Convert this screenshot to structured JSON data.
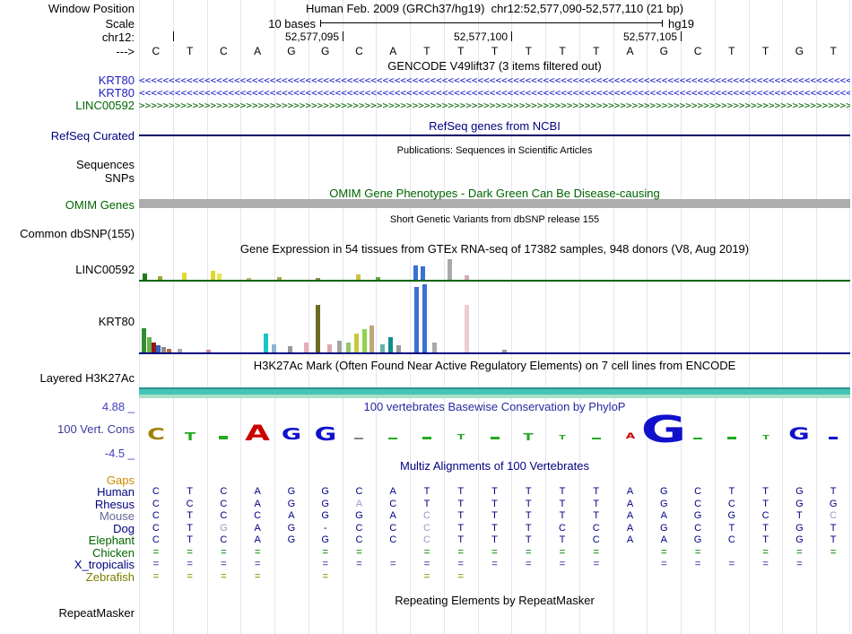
{
  "colors": {
    "grid": "#e2e5f2",
    "navy": "#000080",
    "light_base": "#9a9ac8",
    "gencode_blue": "#2020c8",
    "gene_green": "#006400",
    "omim_bar": "#adadad",
    "band_teal": "#45c4b4",
    "gaps_orange": "#cc8800",
    "phylop_scale_blue": "#4040c0"
  },
  "header": {
    "window_position_label": "Window Position",
    "title": "Human Feb. 2009 (GRCh37/hg19)  chr12:52,577,090-52,577,110 (21 bp)",
    "scale_label": "Scale",
    "scale_value": "10 bases",
    "assembly": "hg19",
    "chrom_label": "chr12:",
    "strand_label": "--->",
    "position_ticks": [
      {
        "label": "",
        "boundary": 1
      },
      {
        "label": "52,577,095",
        "boundary": 6
      },
      {
        "label": "52,577,100",
        "boundary": 11
      },
      {
        "label": "52,577,105",
        "boundary": 16
      }
    ],
    "sequence": [
      "C",
      "T",
      "C",
      "A",
      "G",
      "G",
      "C",
      "A",
      "T",
      "T",
      "T",
      "T",
      "T",
      "T",
      "A",
      "G",
      "C",
      "T",
      "T",
      "G",
      "T"
    ]
  },
  "tracks": {
    "gencode": {
      "title": "GENCODE V49lift37 (3 items filtered out)",
      "items": [
        {
          "label": "KRT80",
          "direction": "<",
          "color": "#2020c8"
        },
        {
          "label": "KRT80",
          "direction": "<",
          "color": "#2020c8"
        },
        {
          "label": "LINC00592",
          "direction": ">",
          "color": "#006400"
        }
      ]
    },
    "refseq": {
      "title": "RefSeq genes from NCBI",
      "label": "RefSeq Curated"
    },
    "publications": {
      "title": "Publications: Sequences in Scientific Articles",
      "labels": [
        "Sequences",
        "SNPs"
      ]
    },
    "omim": {
      "title": "OMIM Gene Phenotypes - Dark Green Can Be Disease-causing",
      "label": "OMIM Genes"
    },
    "dbsnp": {
      "title": "Short Genetic Variants from dbSNP release 155",
      "label": "Common dbSNP(155)"
    },
    "gtex": {
      "title": "Gene Expression in 54 tissues from GTEx RNA-seq of 17382 samples, 948 donors (V8, Aug 2019)",
      "genes": [
        {
          "label": "LINC00592",
          "baseline_color": "#006400",
          "bars": [
            [
              4,
              8,
              "#1f7a1f"
            ],
            [
              21,
              5,
              "#9aa832"
            ],
            [
              48,
              9,
              "#e0d939"
            ],
            [
              80,
              11,
              "#ded52f"
            ],
            [
              87,
              8,
              "#eae54f"
            ],
            [
              120,
              3,
              "#bbbb66"
            ],
            [
              154,
              4,
              "#a8a84a"
            ],
            [
              197,
              3,
              "#8a8a4a"
            ],
            [
              242,
              7,
              "#cdc344"
            ],
            [
              264,
              4,
              "#6aa24a"
            ],
            [
              306,
              17,
              "#3b6fd4"
            ],
            [
              314,
              16,
              "#3b6fd4"
            ],
            [
              344,
              24,
              "#a9a9a9"
            ],
            [
              363,
              6,
              "#d9a9b9"
            ]
          ]
        },
        {
          "label": "KRT80",
          "baseline_color": "#000080",
          "bars": [
            [
              3,
              28,
              "#2f8f2f"
            ],
            [
              9,
              18,
              "#6ab04c"
            ],
            [
              14,
              12,
              "#8b1a1a"
            ],
            [
              19,
              9,
              "#3a5fbf"
            ],
            [
              25,
              7,
              "#8a8a8a"
            ],
            [
              31,
              5,
              "#b06a3a"
            ],
            [
              43,
              5,
              "#a9a9a9"
            ],
            [
              75,
              4,
              "#c98a9a"
            ],
            [
              139,
              22,
              "#19c5c5"
            ],
            [
              148,
              10,
              "#8ab4d9"
            ],
            [
              166,
              8,
              "#979797"
            ],
            [
              184,
              12,
              "#e8a9b9"
            ],
            [
              197,
              54,
              "#6b6b22"
            ],
            [
              210,
              10,
              "#d9a9a9"
            ],
            [
              221,
              14,
              "#a3a3a3"
            ],
            [
              231,
              12,
              "#95c46a"
            ],
            [
              240,
              22,
              "#c9c93a"
            ],
            [
              249,
              27,
              "#8fd44f"
            ],
            [
              257,
              31,
              "#bda87a"
            ],
            [
              269,
              10,
              "#6ab0b0"
            ],
            [
              278,
              18,
              "#0f8f8f"
            ],
            [
              287,
              9,
              "#9a9a9a"
            ],
            [
              307,
              74,
              "#3b6fd4"
            ],
            [
              316,
              77,
              "#3b6fd4"
            ],
            [
              327,
              12,
              "#a9a9a9"
            ],
            [
              363,
              54,
              "#eccbd2"
            ],
            [
              405,
              4,
              "#9a9a9a"
            ]
          ]
        }
      ]
    },
    "h3k27ac": {
      "title": "H3K27Ac Mark (Often Found Near Active Regulatory Elements) on 7 cell lines from ENCODE",
      "label": "Layered H3K27Ac"
    },
    "conservation": {
      "title": "100 vertebrates Basewise Conservation by PhyloP",
      "label": "100 Vert. Cons",
      "scale_max": "4.88 _",
      "scale_min": "-4.5 _",
      "logo": [
        {
          "l": "C",
          "c": "#a08000",
          "h": 13
        },
        {
          "l": "T",
          "c": "#22aa22",
          "h": 9
        },
        {
          "l": "-",
          "c": "#22aa22",
          "h": 4
        },
        {
          "l": "A",
          "c": "#cc0000",
          "h": 18
        },
        {
          "l": "G",
          "c": "#1111cc",
          "h": 13
        },
        {
          "l": "G",
          "c": "#1111cc",
          "h": 15
        },
        {
          "l": "-",
          "c": "#888888",
          "h": 2
        },
        {
          "l": "-",
          "c": "#22aa22",
          "h": 2
        },
        {
          "l": "-",
          "c": "#22aa22",
          "h": 3
        },
        {
          "l": "T",
          "c": "#22aa22",
          "h": 6
        },
        {
          "l": "-",
          "c": "#22aa22",
          "h": 3
        },
        {
          "l": "T",
          "c": "#22aa22",
          "h": 8
        },
        {
          "l": "T",
          "c": "#22aa22",
          "h": 5
        },
        {
          "l": "-",
          "c": "#22aa22",
          "h": 2
        },
        {
          "l": "A",
          "c": "#cc0000",
          "h": 7
        },
        {
          "l": "G",
          "c": "#1111cc",
          "h": 30
        },
        {
          "l": "-",
          "c": "#22aa22",
          "h": 2
        },
        {
          "l": "-",
          "c": "#22aa22",
          "h": 3
        },
        {
          "l": "T",
          "c": "#22aa22",
          "h": 5
        },
        {
          "l": "G",
          "c": "#1111cc",
          "h": 14
        },
        {
          "l": "-",
          "c": "#1111cc",
          "h": 3
        }
      ]
    },
    "multiz": {
      "title": "Multiz Alignments of 100 Vertebrates",
      "gaps_label": "Gaps",
      "species": [
        {
          "name": "Human",
          "color": "#000080",
          "eq": "#000080",
          "cells": [
            "C",
            "T",
            "C",
            "A",
            "G",
            "G",
            "C",
            "A",
            "T",
            "T",
            "T",
            "T",
            "T",
            "T",
            "A",
            "G",
            "C",
            "T",
            "T",
            "G",
            "T"
          ]
        },
        {
          "name": "Rhesus",
          "color": "#000080",
          "eq": "#000080",
          "cells": [
            "C",
            "C",
            "C",
            "A",
            "G",
            "G",
            "a",
            "C",
            "T",
            "T",
            "T",
            "T",
            "T",
            "T",
            "A",
            "G",
            "C",
            "C",
            "T",
            "G",
            "G"
          ]
        },
        {
          "name": "Mouse",
          "color": "#666699",
          "eq": "#666699",
          "cells": [
            "C",
            "T",
            "C",
            "C",
            "A",
            "G",
            "G",
            "A",
            "c",
            "T",
            "T",
            "T",
            "T",
            "T",
            "A",
            "A",
            "G",
            "G",
            "C",
            "T",
            "c"
          ]
        },
        {
          "name": "Dog",
          "color": "#000080",
          "eq": "#000080",
          "cells": [
            "C",
            "T",
            "g",
            "A",
            "G",
            "-",
            "C",
            "C",
            "c",
            "T",
            "T",
            "T",
            "C",
            "C",
            "A",
            "G",
            "C",
            "T",
            "T",
            "G",
            "T"
          ]
        },
        {
          "name": "Elephant",
          "color": "#006400",
          "eq": "#006400",
          "cells": [
            "C",
            "T",
            "C",
            "A",
            "G",
            "G",
            "C",
            "C",
            "c",
            "T",
            "T",
            "T",
            "T",
            "C",
            "A",
            "A",
            "G",
            "C",
            "T",
            "G",
            "T"
          ]
        },
        {
          "name": "Chicken",
          "color": "#006400",
          "eq": "#44a044",
          "cells": [
            "=",
            "=",
            "=",
            "=",
            "",
            "=",
            "=",
            "",
            "=",
            "=",
            "=",
            "=",
            "=",
            "=",
            "",
            "=",
            "=",
            "",
            "=",
            "=",
            "="
          ]
        },
        {
          "name": "X_tropicalis",
          "color": "#000080",
          "eq": "#7070b8",
          "cells": [
            "=",
            "=",
            "=",
            "=",
            "",
            "=",
            "=",
            "=",
            "=",
            "=",
            "=",
            "=",
            "=",
            "=",
            "",
            "=",
            "=",
            "=",
            "=",
            "=",
            ""
          ]
        },
        {
          "name": "Zebrafish",
          "color": "#7c7c00",
          "eq": "#a8a838",
          "cells": [
            "=",
            "=",
            "=",
            "=",
            "",
            "=",
            "",
            "",
            "=",
            "=",
            "",
            "",
            "",
            "",
            "",
            "",
            "",
            "",
            "",
            "",
            ""
          ]
        }
      ]
    },
    "repeatmasker": {
      "title": "Repeating Elements by RepeatMasker",
      "label": "RepeatMasker"
    }
  }
}
